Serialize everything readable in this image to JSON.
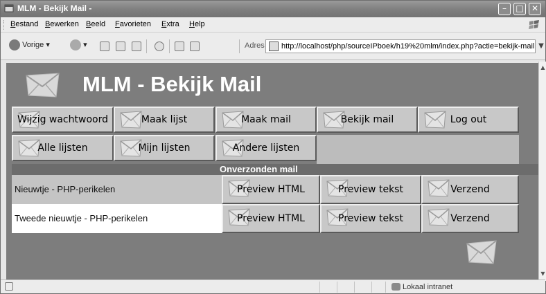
{
  "window": {
    "title": "MLM - Bekijk Mail -"
  },
  "menu": {
    "items": [
      "Bestand",
      "Bewerken",
      "Beeld",
      "Favorieten",
      "Extra",
      "Help"
    ]
  },
  "toolbar": {
    "back_label": "Vorige",
    "address_label": "Adres",
    "address_value": "http://localhost/php/sourceIPboek/h19%20mlm/index.php?actie=bekijk-mail"
  },
  "page": {
    "title": "MLM - Bekijk Mail",
    "nav_row1": [
      "Wijzig wachtwoord",
      "Maak lijst",
      "Maak mail",
      "Bekijk mail",
      "Log out"
    ],
    "nav_row2": [
      "Alle lijsten",
      "Mijn lijsten",
      "Andere lijsten"
    ],
    "section_title": "Onverzonden mail",
    "mails": [
      {
        "subject": "Nieuwtje - PHP-perikelen",
        "preview_html": "Preview HTML",
        "preview_text": "Preview tekst",
        "send": "Verzend"
      },
      {
        "subject": "Tweede nieuwtje - PHP-perikelen",
        "preview_html": "Preview HTML",
        "preview_text": "Preview tekst",
        "send": "Verzend"
      }
    ]
  },
  "status": {
    "zone": "Lokaal intranet"
  },
  "colors": {
    "page_bg": "#7d7d7d",
    "button_bg": "#c8c8c8",
    "row_odd_bg": "#c4c4c4",
    "row_even_bg": "#ffffff"
  }
}
